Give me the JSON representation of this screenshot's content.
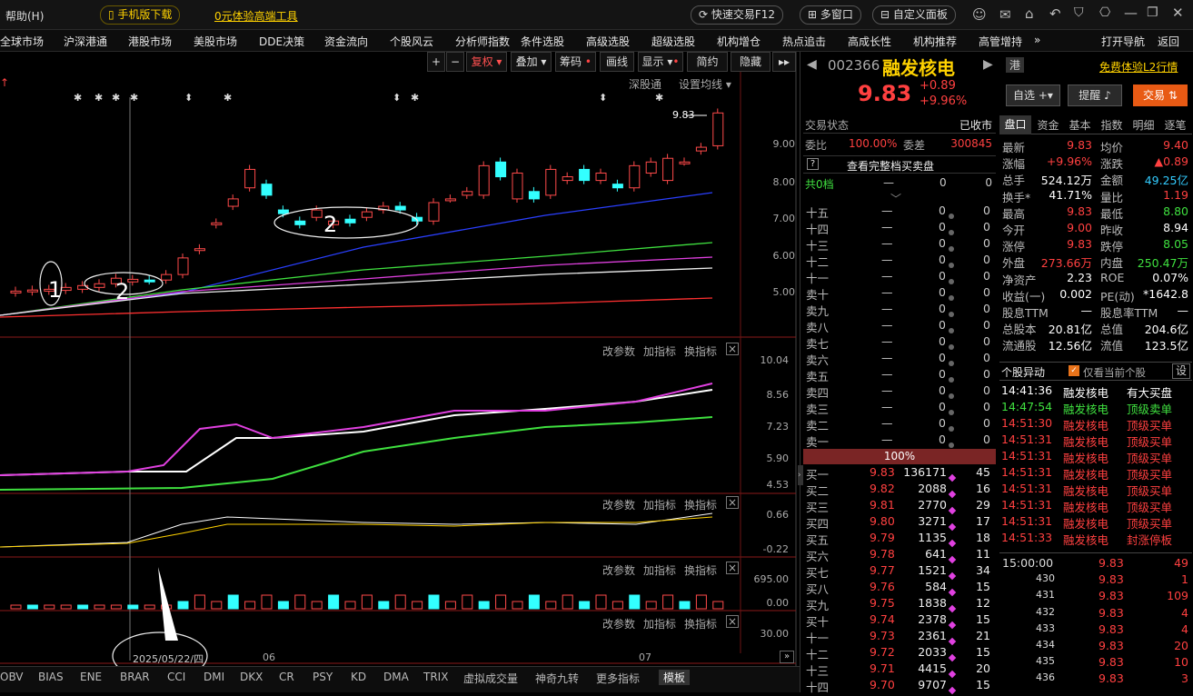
{
  "topbar": {
    "help": "帮助(H)",
    "mobile": "手机版下载",
    "promo": "0元体验高端工具",
    "quick_trade": "快速交易F12",
    "multi_window": "多窗口",
    "custom_panel": "自定义面板"
  },
  "menu": [
    "全球市场",
    "沪深港通",
    "港股市场",
    "美股市场",
    "DDE决策",
    "资金流向",
    "个股风云",
    "分析师指数",
    "条件选股",
    "高级选股",
    "超级选股",
    "机构增仓",
    "热点追击",
    "高成长性",
    "机构推荐",
    "高管增持"
  ],
  "menu_more": "»",
  "menu_right": {
    "nav": "打开导航",
    "back": "返回"
  },
  "toolbar": {
    "plus": "+",
    "minus": "−",
    "fuquan": "复权",
    "overlay": "叠加",
    "chouma": "筹码",
    "huaxian": "画线",
    "display": "显示",
    "simple": "简约",
    "hide": "隐藏",
    "expand": "▸▸"
  },
  "chart_header": {
    "shgt": "深股通",
    "ma_setting": "设置均线"
  },
  "price_tag": "9.83",
  "axis_main": [
    "9.00",
    "8.00",
    "7.00",
    "6.00",
    "5.00"
  ],
  "panel_ctrl": {
    "params": "改参数",
    "add": "加指标",
    "switch": "换指标",
    "close": "×"
  },
  "axis_sub1": [
    "10.04",
    "8.56",
    "7.23",
    "5.90",
    "4.53"
  ],
  "axis_sub2": [
    "0.66",
    "-0.22"
  ],
  "axis_sub3": [
    "695.00",
    "0.00"
  ],
  "axis_sub4": [
    "30.00"
  ],
  "annotations": {
    "a1": "1",
    "a2": "2",
    "a3": "2"
  },
  "date_tag": "2025/05/22/四",
  "months": {
    "m6": "06",
    "m7": "07"
  },
  "bottom_tabs": [
    "OBV",
    "BIAS",
    "ENE",
    "BRAR",
    "CCI",
    "DMI",
    "DKX",
    "CR",
    "PSY",
    "KD",
    "DMA",
    "TRIX",
    "虚拟成交量",
    "神奇九转",
    "更多指标",
    "模板"
  ],
  "stock": {
    "code": "002366",
    "name": "融发核电",
    "hk": "港",
    "price": "9.83",
    "change": "+0.89",
    "pct": "+9.96%",
    "l2": "免费体验L2行情",
    "zixuan": "自选",
    "tixing": "提醒",
    "jiaoyi": "交易"
  },
  "trade_status": {
    "label": "交易状态",
    "value": "已收市"
  },
  "weibi": {
    "label": "委比",
    "value": "100.00%",
    "wc_label": "委差",
    "wc_value": "300845"
  },
  "full_book": "查看完整档买卖盘",
  "gong": {
    "label": "共0档",
    "dash": "—",
    "v1": "0",
    "v2": "0"
  },
  "sell_levels": [
    "十五",
    "十四",
    "十三",
    "十二",
    "十一",
    "卖十",
    "卖九",
    "卖八",
    "卖七",
    "卖六",
    "卖五",
    "卖四",
    "卖三",
    "卖二",
    "卖一"
  ],
  "sell_dash": "—",
  "sell_zero": "0",
  "pct_bar": "100%",
  "buy_levels": [
    {
      "n": "买一",
      "p": "9.83",
      "v": "136171",
      "c": "45"
    },
    {
      "n": "买二",
      "p": "9.82",
      "v": "2088",
      "c": "16"
    },
    {
      "n": "买三",
      "p": "9.81",
      "v": "2770",
      "c": "29"
    },
    {
      "n": "买四",
      "p": "9.80",
      "v": "3271",
      "c": "17"
    },
    {
      "n": "买五",
      "p": "9.79",
      "v": "1135",
      "c": "18"
    },
    {
      "n": "买六",
      "p": "9.78",
      "v": "641",
      "c": "11"
    },
    {
      "n": "买七",
      "p": "9.77",
      "v": "1521",
      "c": "34"
    },
    {
      "n": "买八",
      "p": "9.76",
      "v": "584",
      "c": "15"
    },
    {
      "n": "买九",
      "p": "9.75",
      "v": "1838",
      "c": "12"
    },
    {
      "n": "买十",
      "p": "9.74",
      "v": "2378",
      "c": "15"
    },
    {
      "n": "十一",
      "p": "9.73",
      "v": "2361",
      "c": "21"
    },
    {
      "n": "十二",
      "p": "9.72",
      "v": "2033",
      "c": "15"
    },
    {
      "n": "十三",
      "p": "9.71",
      "v": "4415",
      "c": "20"
    },
    {
      "n": "十四",
      "p": "9.70",
      "v": "9707",
      "c": "15"
    }
  ],
  "tabs": [
    "盘口",
    "资金",
    "基本",
    "指数",
    "明细",
    "逐笔"
  ],
  "quote": [
    [
      "最新",
      "9.83",
      "均价",
      "9.40"
    ],
    [
      "涨幅",
      "+9.96%",
      "涨跌",
      "▲0.89"
    ],
    [
      "总手",
      "524.12万",
      "金额",
      "49.25亿"
    ],
    [
      "换手*",
      "41.71%",
      "量比",
      "1.19"
    ],
    [
      "最高",
      "9.83",
      "最低",
      "8.80"
    ],
    [
      "今开",
      "9.00",
      "昨收",
      "8.94"
    ],
    [
      "涨停",
      "9.83",
      "跌停",
      "8.05"
    ],
    [
      "外盘",
      "273.66万",
      "内盘",
      "250.47万"
    ],
    [
      "净资产",
      "2.23",
      "ROE",
      "0.07%"
    ],
    [
      "收益(一)",
      "0.002",
      "PE(动)",
      "*1642.8"
    ],
    [
      "股息TTM",
      "—",
      "股息率TTM",
      "—"
    ],
    [
      "总股本",
      "20.81亿",
      "总值",
      "204.6亿"
    ],
    [
      "流通股",
      "12.56亿",
      "流值",
      "123.5亿"
    ]
  ],
  "anomaly": {
    "title": "个股异动",
    "only_current": "仅看当前个股",
    "set": "设",
    "rows": [
      [
        "14:41:36",
        "融发核电",
        "有大买盘"
      ],
      [
        "14:47:54",
        "融发核电",
        "顶级卖单"
      ],
      [
        "14:51:30",
        "融发核电",
        "顶级买单"
      ],
      [
        "14:51:31",
        "融发核电",
        "顶级买单"
      ],
      [
        "14:51:31",
        "融发核电",
        "顶级买单"
      ],
      [
        "14:51:31",
        "融发核电",
        "顶级买单"
      ],
      [
        "14:51:31",
        "融发核电",
        "顶级买单"
      ],
      [
        "14:51:31",
        "融发核电",
        "顶级买单"
      ],
      [
        "14:51:31",
        "融发核电",
        "顶级买单"
      ],
      [
        "14:51:33",
        "融发核电",
        "封涨停板"
      ]
    ]
  },
  "ticks": [
    [
      "15:00:00",
      "9.83",
      "49"
    ],
    [
      "430",
      "9.83",
      "1"
    ],
    [
      "431",
      "9.83",
      "109"
    ],
    [
      "432",
      "9.83",
      "4"
    ],
    [
      "433",
      "9.83",
      "4"
    ],
    [
      "434",
      "9.83",
      "20"
    ],
    [
      "435",
      "9.83",
      "10"
    ],
    [
      "436",
      "9.83",
      "3"
    ]
  ]
}
